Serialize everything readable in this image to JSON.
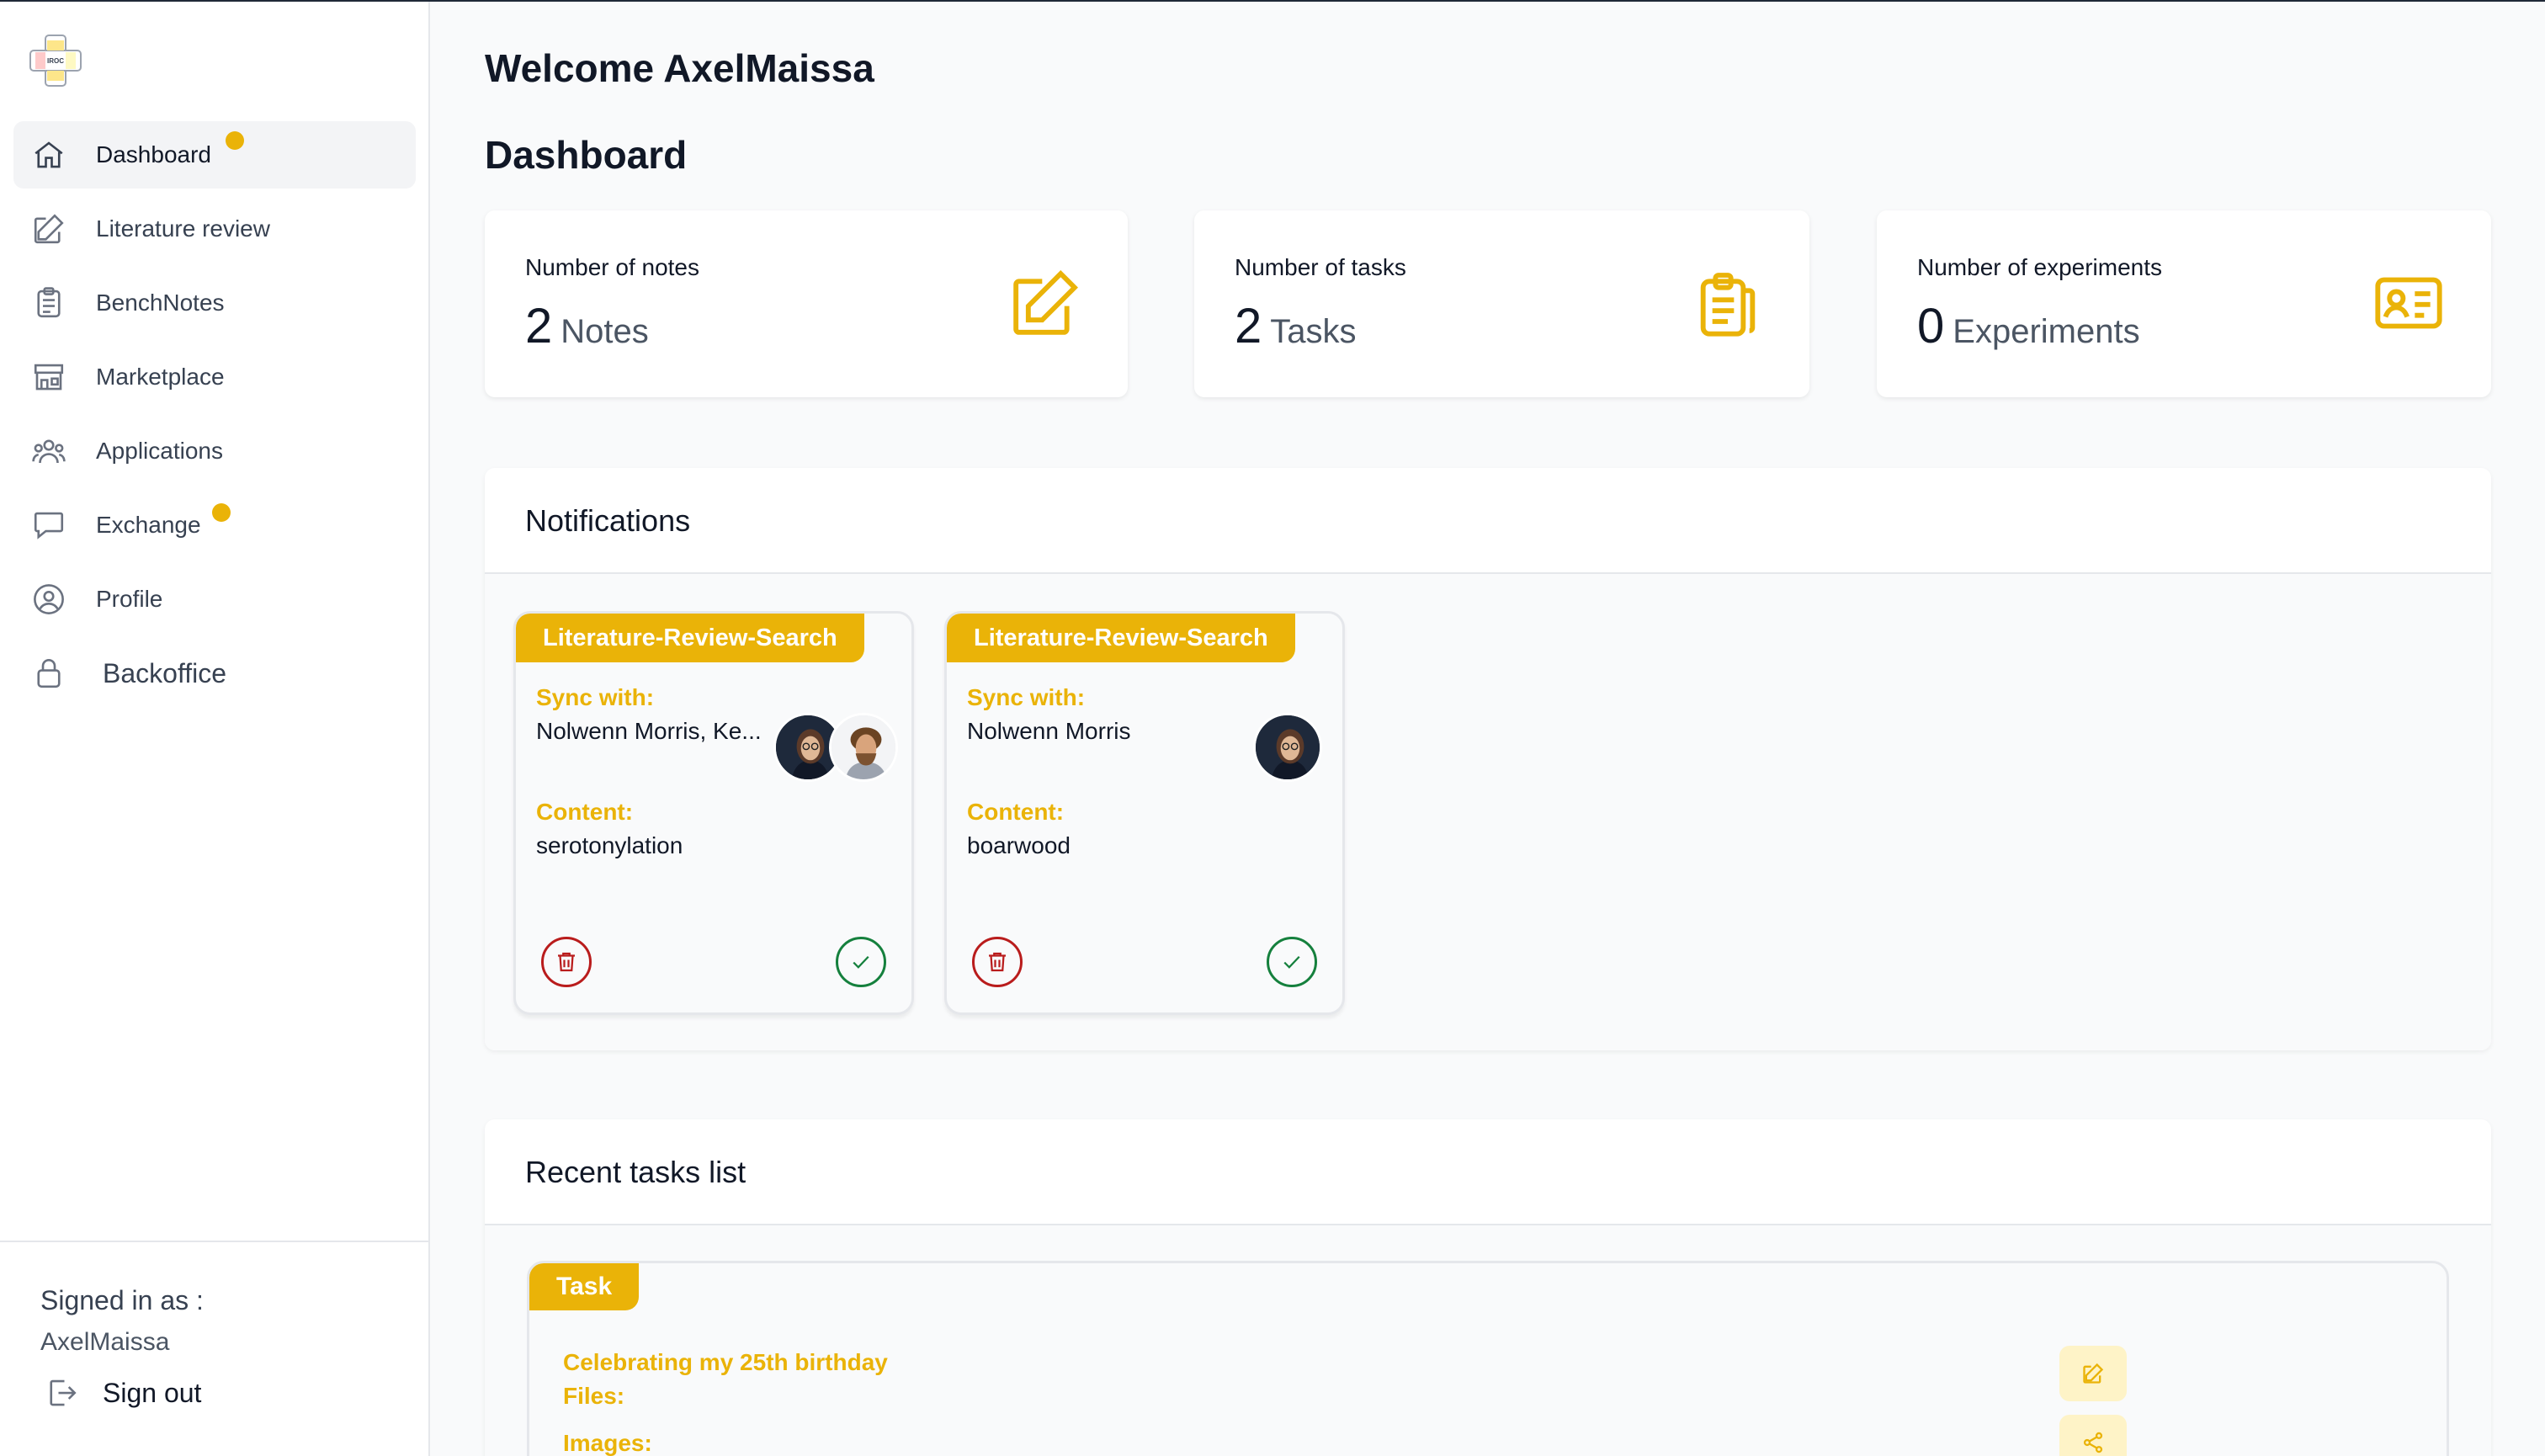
{
  "app": {
    "logo_text": "IROC"
  },
  "sidebar": {
    "items": [
      {
        "label": "Dashboard",
        "icon": "home-icon"
      },
      {
        "label": "Literature review",
        "icon": "pencil-square-icon"
      },
      {
        "label": "BenchNotes",
        "icon": "clipboard-icon"
      },
      {
        "label": "Marketplace",
        "icon": "storefront-icon"
      },
      {
        "label": "Applications",
        "icon": "users-group-icon"
      },
      {
        "label": "Exchange",
        "icon": "chat-bubble-icon"
      },
      {
        "label": "Profile",
        "icon": "user-circle-icon"
      },
      {
        "label": "Backoffice",
        "icon": "lock-icon"
      }
    ],
    "signed_in_label": "Signed in as :",
    "username": "AxelMaissa",
    "sign_out": "Sign out",
    "accent": "#eab308"
  },
  "main": {
    "welcome": "Welcome AxelMaissa",
    "title": "Dashboard",
    "stats": [
      {
        "label": "Number of notes",
        "value": "2",
        "unit": "Notes",
        "icon": "edit-icon"
      },
      {
        "label": "Number of tasks",
        "value": "2",
        "unit": "Tasks",
        "icon": "clipboard-list-icon"
      },
      {
        "label": "Number of experiments",
        "value": "0",
        "unit": "Experiments",
        "icon": "id-card-icon"
      }
    ],
    "notifications": {
      "title": "Notifications",
      "cards": [
        {
          "tag": "Literature-Review-Search",
          "sync_label": "Sync with:",
          "sync_value": "Nolwenn Morris, Ke...",
          "content_label": "Content:",
          "content_value": "serotonylation"
        },
        {
          "tag": "Literature-Review-Search",
          "sync_label": "Sync with:",
          "sync_value": "Nolwenn Morris",
          "content_label": "Content:",
          "content_value": "boarwood"
        }
      ]
    },
    "tasks": {
      "title": "Recent tasks list",
      "card": {
        "tag": "Task",
        "name": "Celebrating my 25th birthday",
        "files_label": "Files:",
        "images_label": "Images:"
      }
    }
  }
}
